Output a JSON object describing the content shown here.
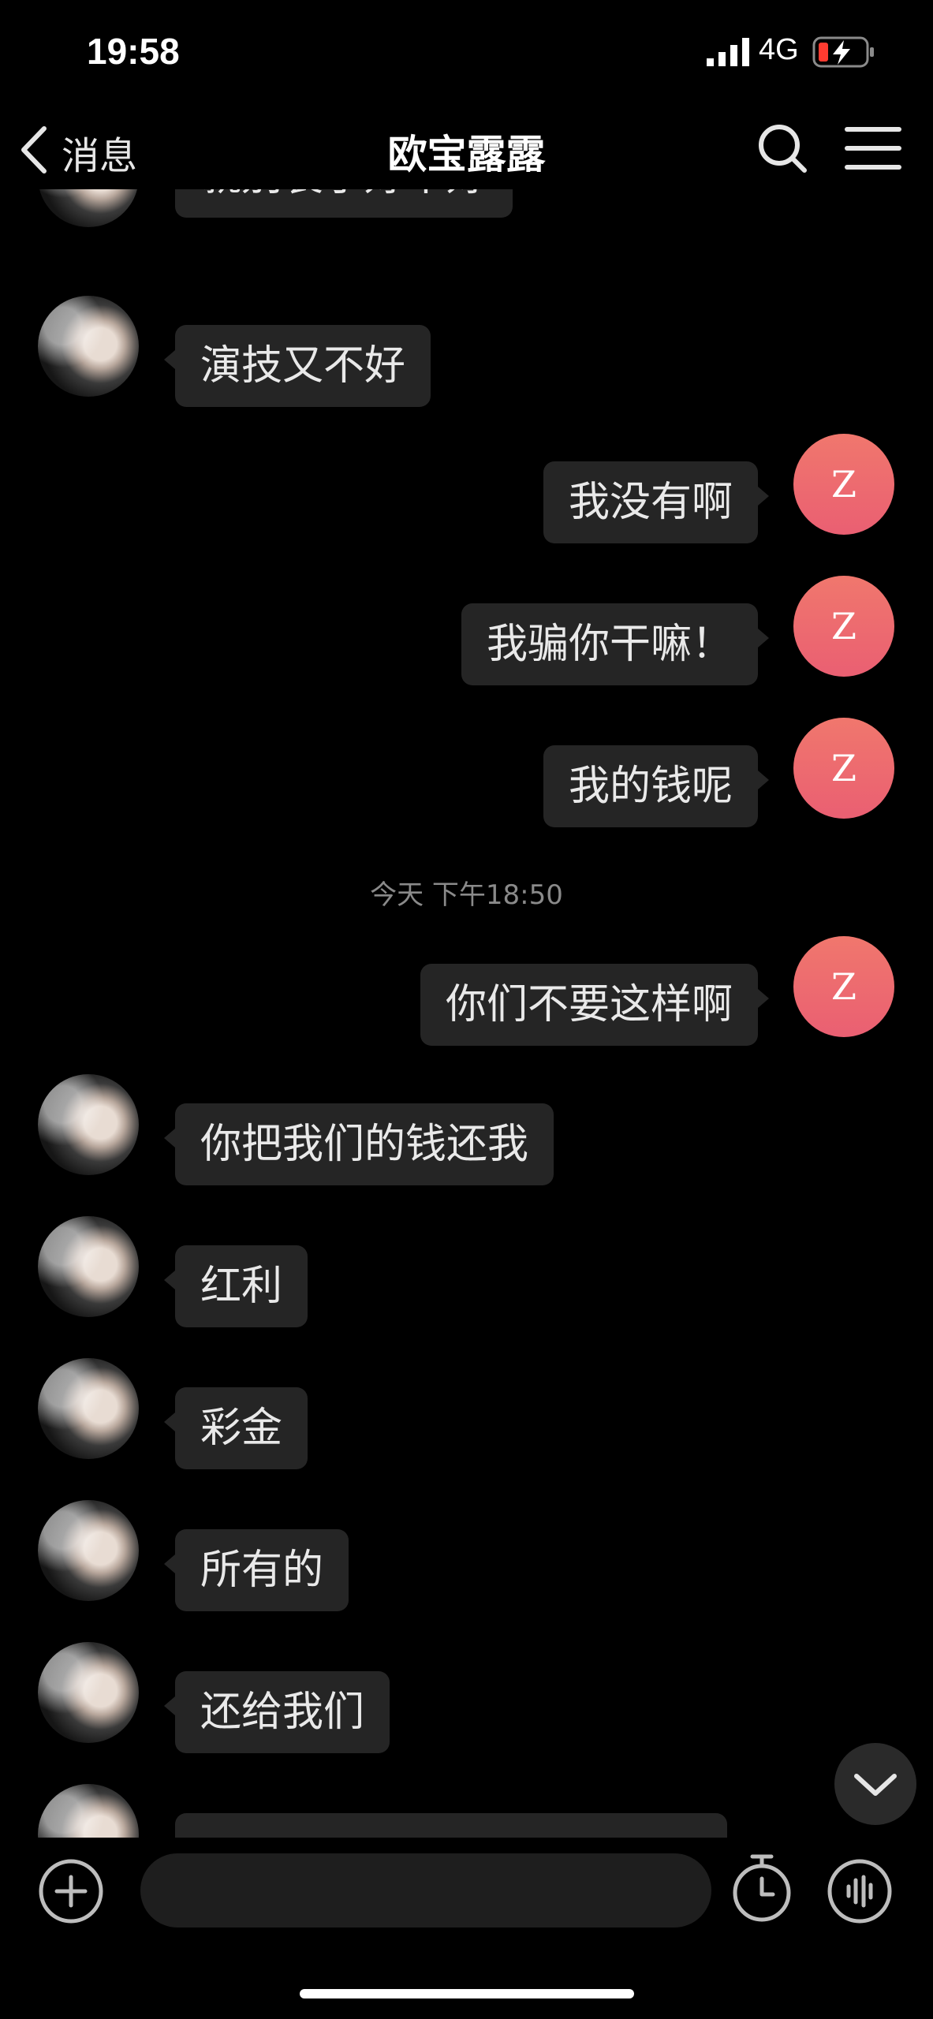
{
  "status_bar": {
    "time": "19:58",
    "network": "4G"
  },
  "header": {
    "back_label": "消息",
    "title": "欧宝露露"
  },
  "messages": {
    "m1": "就别装了好不好",
    "m2": "演技又不好",
    "m3": "我没有啊",
    "m4": "我骗你干嘛！",
    "m5": "我的钱呢",
    "m6": "你们不要这样啊",
    "m7": "你把我们的钱还我",
    "m8": "红利",
    "m9": "彩金",
    "m10": "所有的",
    "m11": "还给我们"
  },
  "timestamp": "今天 下午18:50",
  "my_avatar_letter": "Z",
  "input": {
    "value": ""
  },
  "colors": {
    "background": "#000000",
    "bubble": "#252525",
    "my_avatar": "#ee6a70"
  }
}
